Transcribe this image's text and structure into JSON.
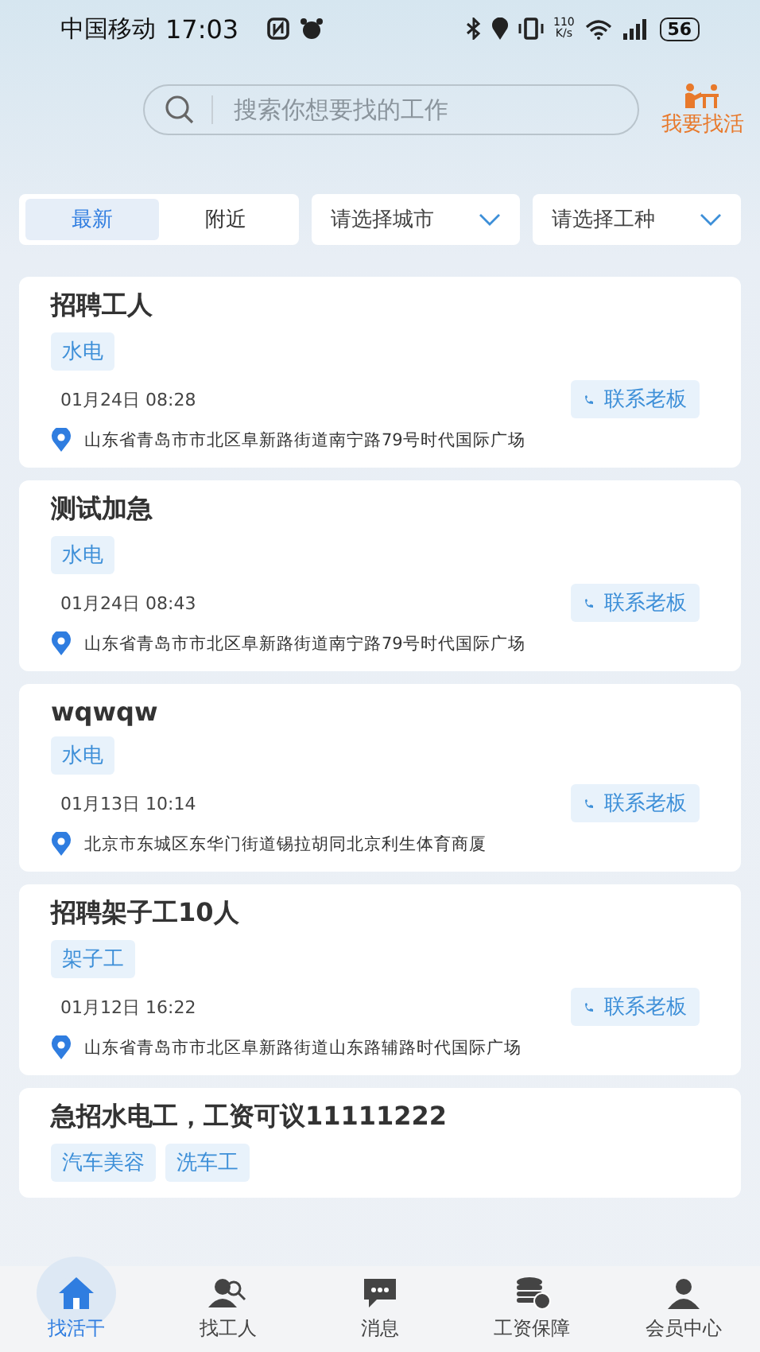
{
  "status_bar": {
    "carrier": "中国移动",
    "time": "17:03",
    "speed": "110 K/s",
    "battery": "56"
  },
  "search": {
    "placeholder": "搜索你想要找的工作"
  },
  "find_work": {
    "label": "我要找活"
  },
  "tabs": [
    {
      "label": "最新",
      "selected": true
    },
    {
      "label": "附近",
      "selected": false
    }
  ],
  "filters": [
    {
      "placeholder": "请选择城市"
    },
    {
      "placeholder": "请选择工种"
    }
  ],
  "jobs": [
    {
      "title": "招聘工人",
      "tags": [
        "水电"
      ],
      "date": "01月24日 08:28",
      "contact": "联系老板",
      "address": "山东省青岛市市北区阜新路街道南宁路79号时代国际广场"
    },
    {
      "title": "测试加急",
      "tags": [
        "水电"
      ],
      "date": "01月24日 08:43",
      "contact": "联系老板",
      "address": "山东省青岛市市北区阜新路街道南宁路79号时代国际广场"
    },
    {
      "title": "wqwqw",
      "tags": [
        "水电"
      ],
      "date": "01月13日 10:14",
      "contact": "联系老板",
      "address": "北京市东城区东华门街道锡拉胡同北京利生体育商厦"
    },
    {
      "title": "招聘架子工10人",
      "tags": [
        "架子工"
      ],
      "date": "01月12日 16:22",
      "contact": "联系老板",
      "address": "山东省青岛市市北区阜新路街道山东路辅路时代国际广场"
    },
    {
      "title": "急招水电工，工资可议11111222",
      "tags": [
        "汽车美容",
        "洗车工"
      ]
    }
  ],
  "nav": [
    {
      "label": "找活干",
      "kind": "home",
      "selected": true
    },
    {
      "label": "找工人",
      "kind": "people",
      "selected": false
    },
    {
      "label": "消息",
      "kind": "chat",
      "selected": false
    },
    {
      "label": "工资保障",
      "kind": "coins",
      "selected": false
    },
    {
      "label": "会员中心",
      "kind": "user",
      "selected": false
    }
  ]
}
